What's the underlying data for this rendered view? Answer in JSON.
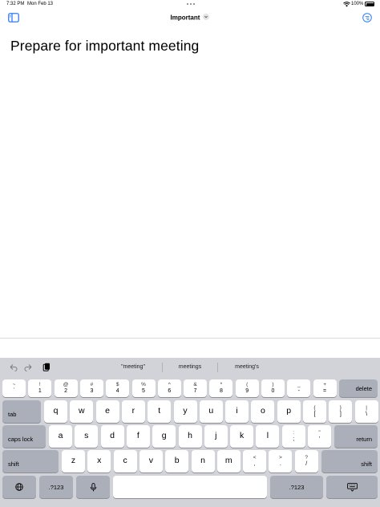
{
  "status_bar": {
    "time": "7:32 PM",
    "date": "Mon Feb 13",
    "battery_percent": "100%",
    "icons": [
      "wifi-icon",
      "battery-icon"
    ]
  },
  "nav_bar": {
    "title": "Important",
    "left_icon": "sidebar-toggle-icon",
    "right_icon": "more-options-icon",
    "accent_color": "#2f7cf6"
  },
  "note": {
    "title": "Prepare for important meeting"
  },
  "keyboard": {
    "toolbar": {
      "icons": [
        "undo-icon",
        "redo-icon",
        "clipboard-icon"
      ],
      "suggestions": [
        "\"meeting\"",
        "meetings",
        "meeting's"
      ]
    },
    "number_row": [
      {
        "up": "~",
        "dn": "`"
      },
      {
        "up": "!",
        "dn": "1"
      },
      {
        "up": "@",
        "dn": "2"
      },
      {
        "up": "#",
        "dn": "3"
      },
      {
        "up": "$",
        "dn": "4"
      },
      {
        "up": "%",
        "dn": "5"
      },
      {
        "up": "^",
        "dn": "6"
      },
      {
        "up": "&",
        "dn": "7"
      },
      {
        "up": "*",
        "dn": "8"
      },
      {
        "up": "(",
        "dn": "9"
      },
      {
        "up": ")",
        "dn": "0"
      },
      {
        "up": "_",
        "dn": "-"
      },
      {
        "up": "+",
        "dn": "="
      }
    ],
    "delete_label": "delete",
    "tab_label": "tab",
    "row_q": [
      "q",
      "w",
      "e",
      "r",
      "t",
      "y",
      "u",
      "i",
      "o",
      "p"
    ],
    "bracket_keys": [
      {
        "up": "{",
        "dn": "["
      },
      {
        "up": "}",
        "dn": "]"
      },
      {
        "up": "|",
        "dn": "\\"
      }
    ],
    "caps_label": "caps lock",
    "row_a": [
      "a",
      "s",
      "d",
      "f",
      "g",
      "h",
      "j",
      "k",
      "l"
    ],
    "punct_a": [
      {
        "up": ":",
        "dn": ";"
      },
      {
        "up": "\"",
        "dn": "'"
      }
    ],
    "return_label": "return",
    "shift_label": "shift",
    "row_z": [
      "z",
      "x",
      "c",
      "v",
      "b",
      "n",
      "m"
    ],
    "punct_z": [
      {
        "up": "<",
        "dn": ","
      },
      {
        "up": ">",
        "dn": "."
      },
      {
        "up": "?",
        "dn": "/"
      }
    ],
    "numbers_label": ".?123",
    "bottom_icons": [
      "globe-icon",
      "microphone-icon",
      "keyboard-dismiss-icon"
    ],
    "key_color": "#ffffff",
    "function_key_color": "#abafb9",
    "background_color": "#d1d3d9"
  }
}
